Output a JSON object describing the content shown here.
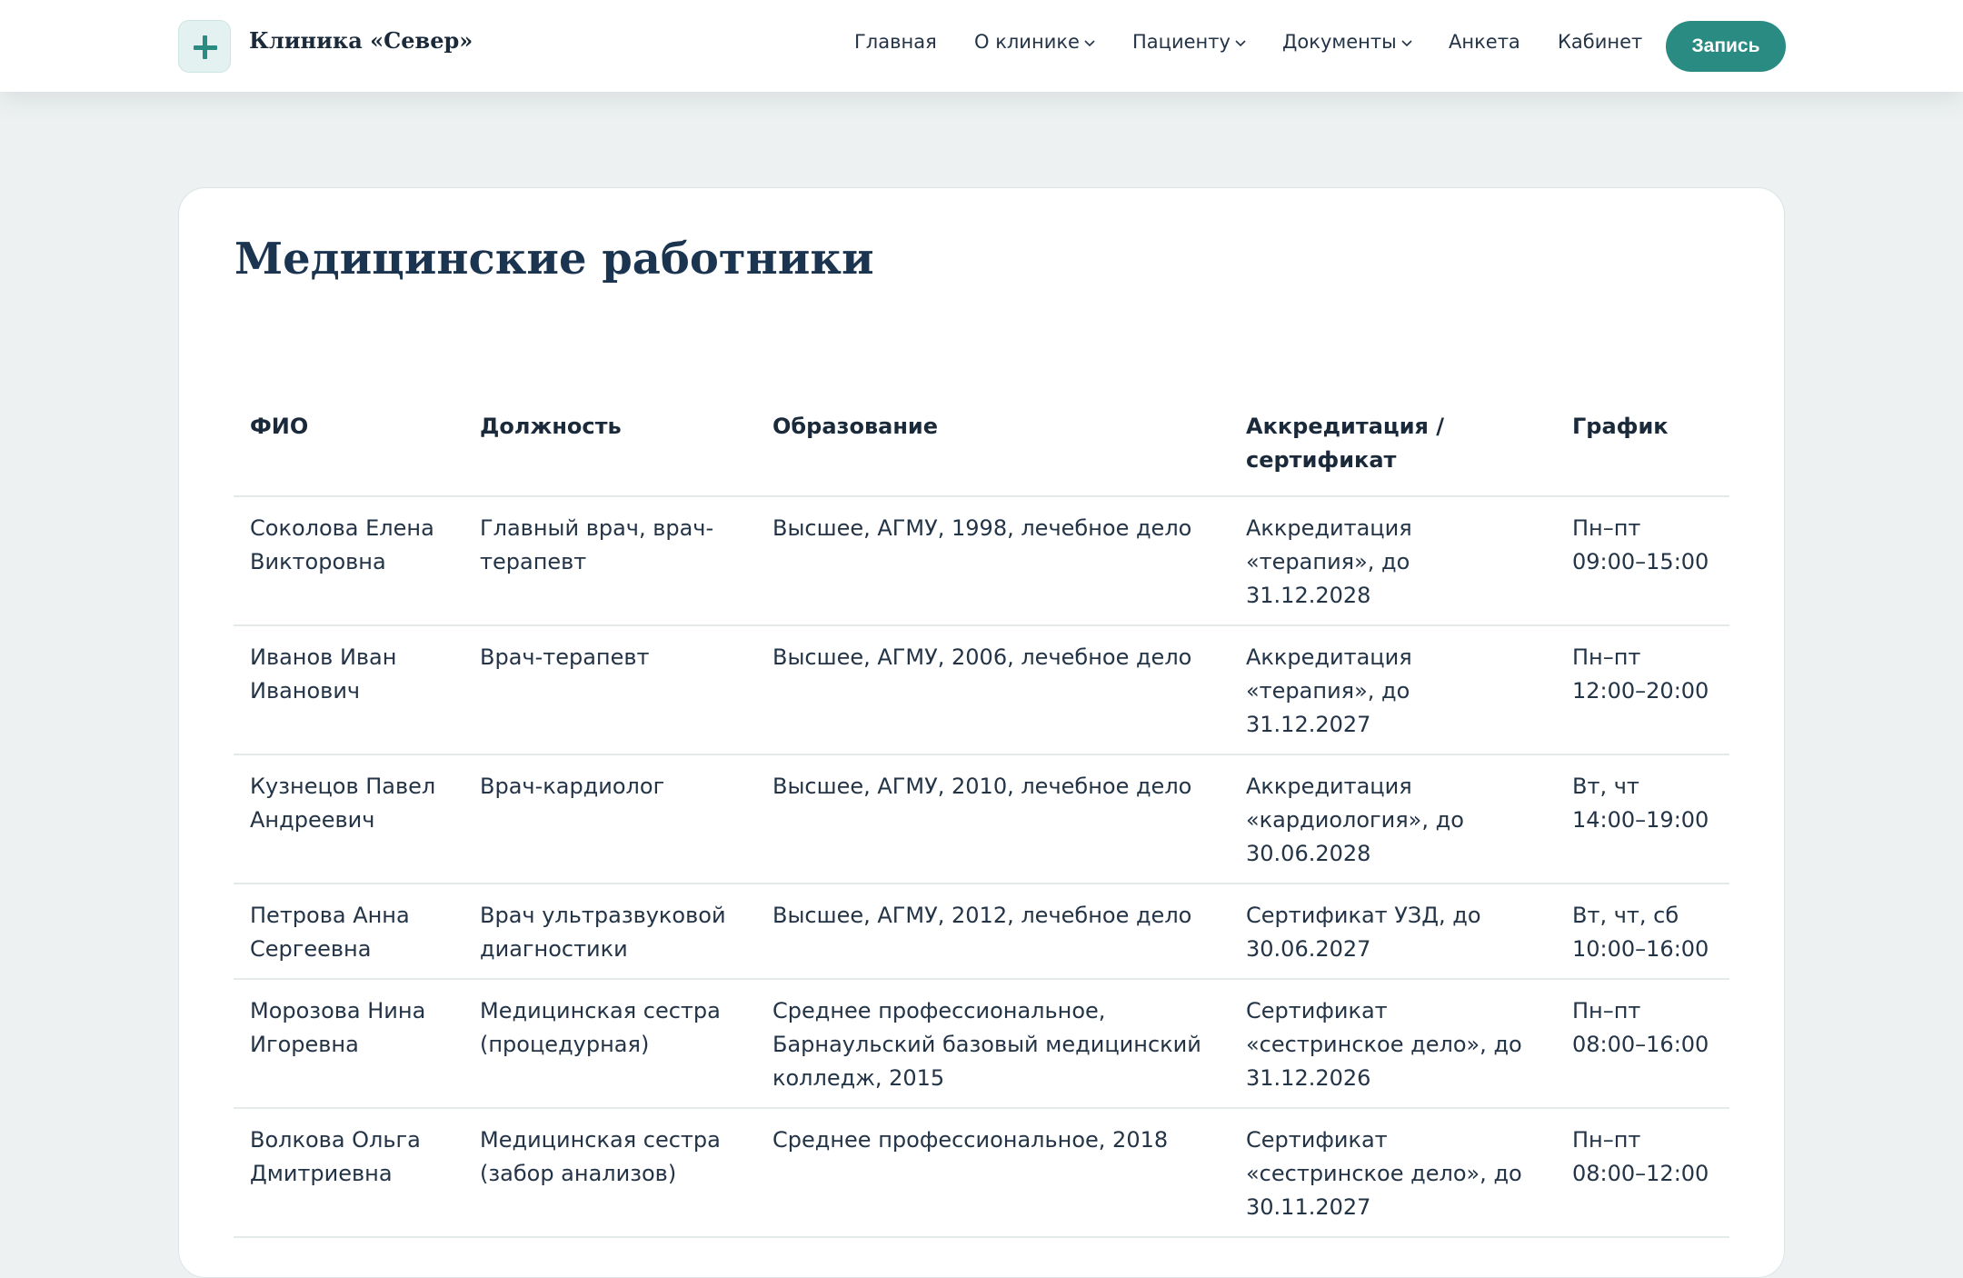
{
  "header": {
    "brand": "Клиника «Север»",
    "logo_icon": "plus-icon",
    "nav": [
      {
        "label": "Главная",
        "dropdown": false
      },
      {
        "label": "О клинике",
        "dropdown": true
      },
      {
        "label": "Пациенту",
        "dropdown": true
      },
      {
        "label": "Документы",
        "dropdown": true
      },
      {
        "label": "Анкета",
        "dropdown": false
      },
      {
        "label": "Кабинет",
        "dropdown": false
      }
    ],
    "cta_label": "Запись"
  },
  "colors": {
    "accent": "#2a8b82",
    "page_bg": "#edf1f1",
    "heading": "#1b3450"
  },
  "main": {
    "title": "Медицинские работники",
    "table": {
      "columns": [
        "ФИО",
        "Должность",
        "Образование",
        "Аккредитация / сертификат",
        "График"
      ],
      "rows": [
        [
          "Соколова Елена Викторовна",
          "Главный врач, врач-терапевт",
          "Высшее, АГМУ, 1998, лечебное дело",
          "Аккредитация «терапия», до 31.12.2028",
          "Пн–пт 09:00–15:00"
        ],
        [
          "Иванов Иван Иванович",
          "Врач-терапевт",
          "Высшее, АГМУ, 2006, лечебное дело",
          "Аккредитация «терапия», до 31.12.2027",
          "Пн–пт 12:00–20:00"
        ],
        [
          "Кузнецов Павел Андреевич",
          "Врач-кардиолог",
          "Высшее, АГМУ, 2010, лечебное дело",
          "Аккредитация «кардиология», до 30.06.2028",
          "Вт, чт 14:00–19:00"
        ],
        [
          "Петрова Анна Сергеевна",
          "Врач ультразвуковой диагностики",
          "Высшее, АГМУ, 2012, лечебное дело",
          "Сертификат УЗД, до 30.06.2027",
          "Вт, чт, сб 10:00–16:00"
        ],
        [
          "Морозова Нина Игоревна",
          "Медицинская сестра (процедурная)",
          "Среднее профессиональное, Барнаульский базовый медицинский колледж, 2015",
          "Сертификат «сестринское дело», до 31.12.2026",
          "Пн–пт 08:00–16:00"
        ],
        [
          "Волкова Ольга Дмитриевна",
          "Медицинская сестра (забор анализов)",
          "Среднее профессиональное, 2018",
          "Сертификат «сестринское дело», до 30.11.2027",
          "Пн–пт 08:00–12:00"
        ]
      ]
    }
  }
}
